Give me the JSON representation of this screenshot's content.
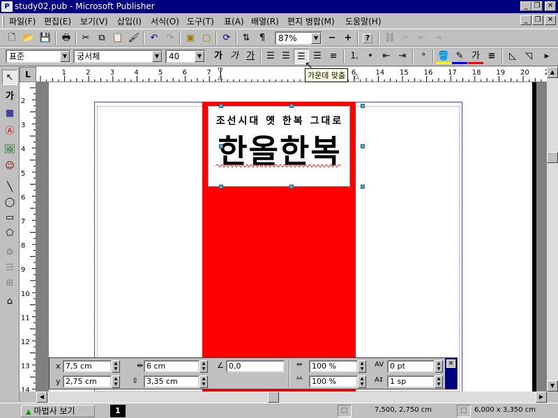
{
  "window": {
    "title": "study02.pub - Microsoft Publisher",
    "minimize": "_",
    "restore": "❐",
    "close": "✕",
    "app_icon": "pub-icon"
  },
  "menu": {
    "items": [
      "파일(F)",
      "편집(E)",
      "보기(V)",
      "삽입(I)",
      "서식(O)",
      "도구(T)",
      "표(A)",
      "배열(R)",
      "편지 병합(M)",
      "도움말(H)"
    ],
    "doc_controls": [
      "_",
      "❐",
      "✕"
    ]
  },
  "standard_toolbar": {
    "zoom": "87%",
    "zoom_out": "−",
    "zoom_in": "+",
    "help": "?"
  },
  "format_toolbar": {
    "style": "표준",
    "font": "궁서체",
    "size": "40",
    "bold": "가",
    "italic": "가",
    "underline": "가",
    "text_color": "가"
  },
  "tooltip": "가운데 맞춤",
  "ruler": {
    "corner": "L",
    "h_labels": [
      "1",
      "2",
      "3",
      "4",
      "5",
      "6",
      "7",
      "1",
      "2",
      "3",
      "4",
      "5",
      "6",
      "14",
      "15",
      "16",
      "17",
      "18",
      "19",
      "20",
      "21"
    ],
    "v_labels": [
      "2",
      "3",
      "4",
      "5",
      "6",
      "7",
      "8",
      "9",
      "10",
      "11",
      "12",
      "13",
      "14"
    ]
  },
  "document": {
    "subtitle": "조선시대 옛 한복 그대로",
    "headline": "한올한복",
    "red_color": "#ff0000",
    "frame_color": "#70a8c8"
  },
  "measurements": {
    "x_label": "x",
    "x_value": "7,5 cm",
    "y_label": "y",
    "y_value": "2,75 cm",
    "width_value": "6 cm",
    "height_value": "3,35 cm",
    "rotation_value": "0,0",
    "text_scale_value": "100 %",
    "char_scale_value": "100 %",
    "kerning_value": "0 pt",
    "line_spacing_value": "1 sp",
    "close": "✕"
  },
  "status": {
    "wizard_button": "마법사 보기",
    "page_number": "1",
    "position": "7,500, 2,750 cm",
    "size": "6,000 x  3,350 cm"
  }
}
